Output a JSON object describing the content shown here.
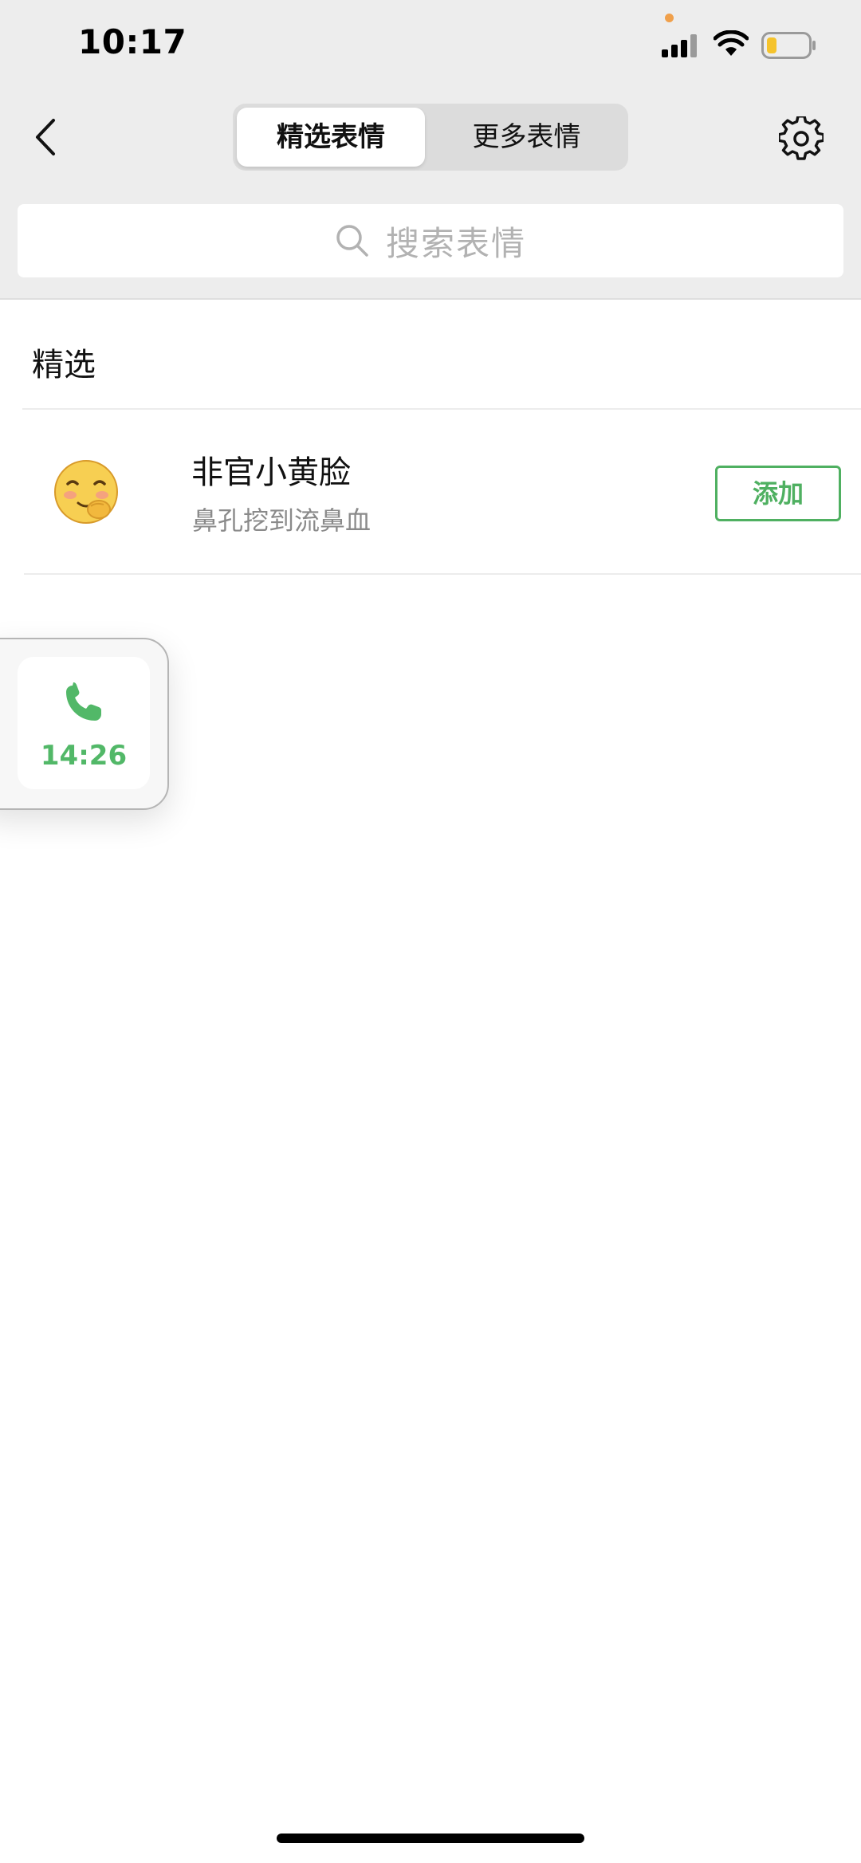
{
  "status_bar": {
    "time": "10:17"
  },
  "nav": {
    "tabs": [
      {
        "label": "精选表情",
        "active": true
      },
      {
        "label": "更多表情",
        "active": false
      }
    ]
  },
  "search": {
    "placeholder": "搜索表情"
  },
  "section": {
    "title": "精选"
  },
  "items": [
    {
      "title": "非官小黄脸",
      "subtitle": "鼻孔挖到流鼻血",
      "action_label": "添加",
      "icon": "smiling-face-icon"
    }
  ],
  "floating_call": {
    "time": "14:26",
    "icon": "phone-icon"
  },
  "colors": {
    "accent_green": "#4fb061",
    "header_bg": "#ededed",
    "call_green": "#52b868"
  }
}
